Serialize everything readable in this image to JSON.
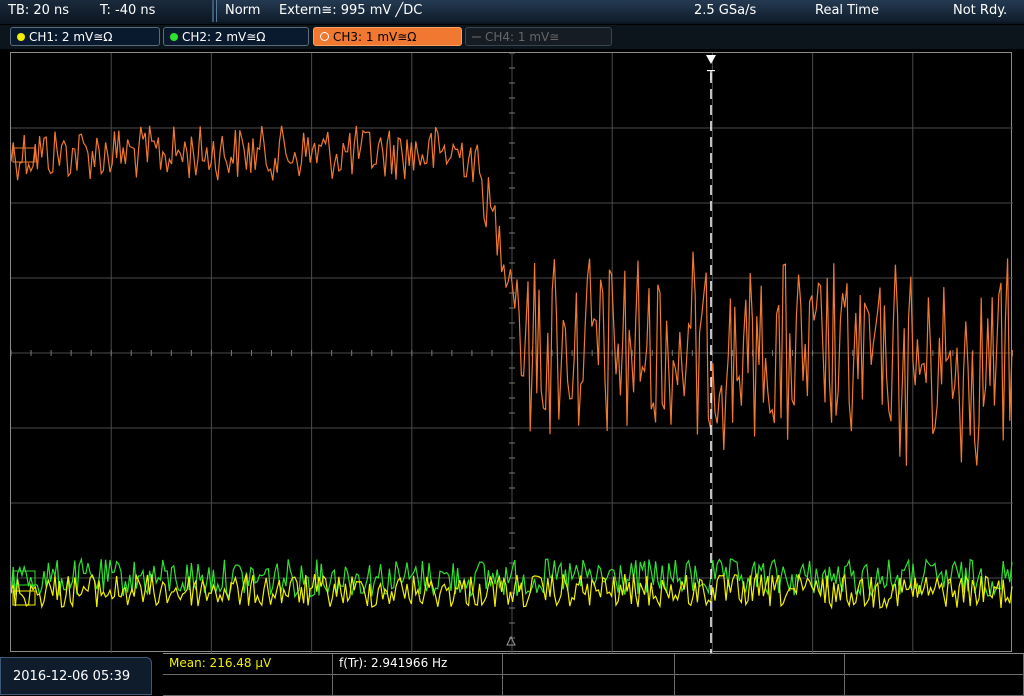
{
  "topbar": {
    "timebase": "TB: 20 ns",
    "trigger_offset": "T: -40 ns",
    "mode": "Norm",
    "trigger_source": "Extern≅: 995 mV ╱DC",
    "sample_rate": "2.5 GSa/s",
    "acq_mode": "Real Time",
    "status": "Not Rdy."
  },
  "channels": [
    {
      "label": "CH1: 2 mV≅Ω",
      "color": "#f0f000"
    },
    {
      "label": "CH2: 2 mV≅Ω",
      "color": "#30e030"
    },
    {
      "label": "CH3: 1 mV≅Ω",
      "color": "#f07830"
    },
    {
      "label": "CH4: 1 mV≅",
      "color": "#555555"
    }
  ],
  "trigger_marker": "T",
  "datetime": "2016-12-06 05:39",
  "measurements": {
    "mean": "Mean: 216.48 µV",
    "frequency": "f(Tr): 2.941966 Hz"
  },
  "colors": {
    "ch1": "#f0f000",
    "ch2": "#30e030",
    "ch3": "#f07830",
    "grid": "#4a4a4a"
  }
}
